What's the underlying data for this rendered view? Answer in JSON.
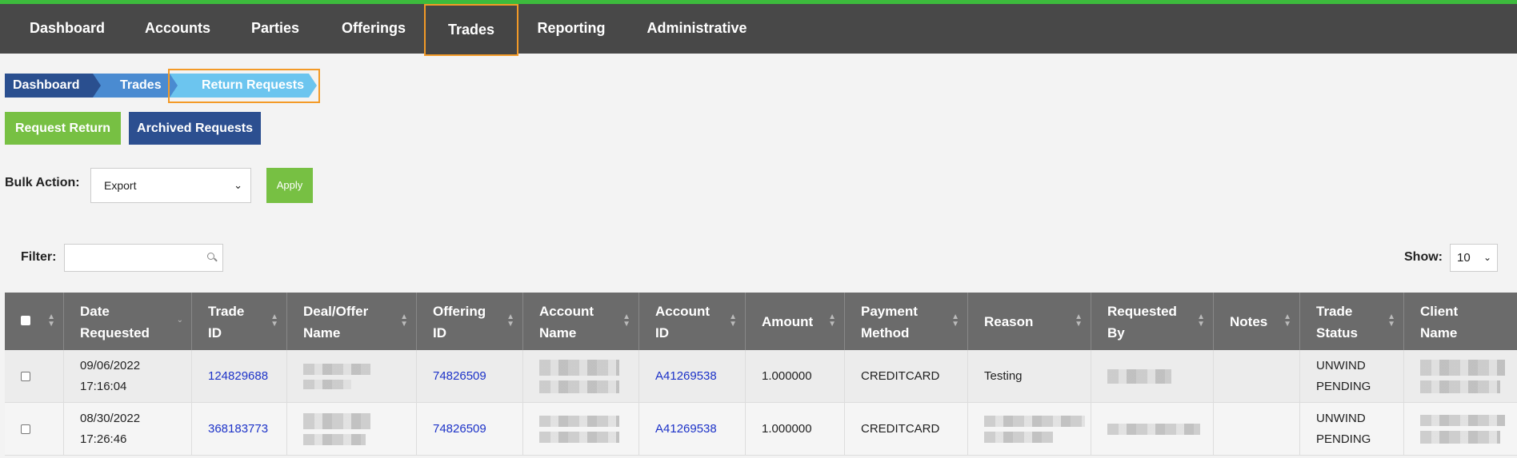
{
  "nav": {
    "items": [
      "Dashboard",
      "Accounts",
      "Parties",
      "Offerings",
      "Trades",
      "Reporting",
      "Administrative"
    ],
    "active": "Trades"
  },
  "breadcrumb": [
    "Dashboard",
    "Trades",
    "Return Requests"
  ],
  "actions": {
    "request_return": "Request Return",
    "archived_requests": "Archived Requests"
  },
  "bulk": {
    "label": "Bulk Action:",
    "selected": "Export",
    "apply": "Apply"
  },
  "filter": {
    "label": "Filter:",
    "value": ""
  },
  "show": {
    "label": "Show:",
    "selected": "10"
  },
  "table": {
    "headers": [
      [
        "Date",
        "Requested"
      ],
      [
        "Trade",
        "ID"
      ],
      [
        "Deal/Offer",
        "Name"
      ],
      [
        "Offering",
        "ID"
      ],
      [
        "Account",
        "Name"
      ],
      [
        "Account",
        "ID"
      ],
      [
        "Amount"
      ],
      [
        "Payment",
        "Method"
      ],
      [
        "Reason"
      ],
      [
        "Requested",
        "By"
      ],
      [
        "Notes"
      ],
      [
        "Trade",
        "Status"
      ],
      [
        "Client",
        "Name"
      ]
    ],
    "rows": [
      {
        "date": "09/06/2022",
        "time": "17:16:04",
        "trade_id": "124829688",
        "offering_id": "74826509",
        "account_id": "A41269538",
        "amount": "1.000000",
        "payment_method": "CREDITCARD",
        "reason": "Testing",
        "notes": "",
        "status_line1": "UNWIND",
        "status_line2": "PENDING"
      },
      {
        "date": "08/30/2022",
        "time": "17:26:46",
        "trade_id": "368183773",
        "offering_id": "74826509",
        "account_id": "A41269538",
        "amount": "1.000000",
        "payment_method": "CREDITCARD",
        "reason": "",
        "notes": "",
        "status_line1": "UNWIND",
        "status_line2": "PENDING"
      }
    ]
  },
  "colors": {
    "nav_bg": "#484848",
    "nav_accent": "#3dbb3d",
    "highlight": "#f39a27",
    "green": "#77c043",
    "blue": "#2c4f90",
    "link": "#1c32c8"
  }
}
